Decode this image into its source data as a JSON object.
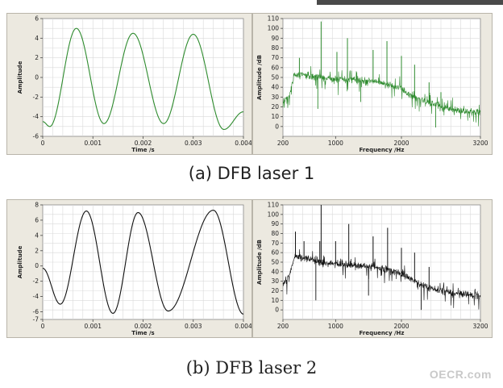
{
  "captions": {
    "a": "(a) DFB laser 1",
    "b": "(b) DFB laser 2"
  },
  "watermark": "OECR.com",
  "colors": {
    "panel_bg": "#ece9e0",
    "plot_bg": "#ffffff",
    "grid": "#d9d9d9",
    "laser1": "#2e8b2e",
    "laser2": "#111111"
  },
  "chart_data": [
    {
      "id": "a_time",
      "type": "line",
      "xlabel": "Time /s",
      "ylabel": "Amplitude",
      "xlim": [
        0,
        0.004
      ],
      "ylim": [
        -6,
        6
      ],
      "xticks": [
        "0",
        "0.001",
        "0.002",
        "0.003",
        "0.004"
      ],
      "yticks": [
        "-6",
        "-4",
        "-2",
        "0",
        "2",
        "4",
        "6"
      ],
      "grid": true,
      "color": "#2e8b2e",
      "series": [
        {
          "x": [
            0,
            0.00014,
            0.00067,
            0.00122,
            0.0018,
            0.00241,
            0.003,
            0.00361,
            0.004
          ],
          "y": [
            -4.5,
            -5.0,
            5.0,
            -4.7,
            4.5,
            -4.7,
            4.4,
            -5.3,
            -3.5
          ]
        }
      ]
    },
    {
      "id": "a_freq",
      "type": "line",
      "xlabel": "Frequency /Hz",
      "ylabel": "Amplitude /dB",
      "xlim": [
        200,
        3200
      ],
      "ylim": [
        -10,
        110
      ],
      "xticks": [
        "200",
        "1000",
        "2000",
        "3200"
      ],
      "yticks": [
        "0",
        "10",
        "20",
        "30",
        "40",
        "50",
        "60",
        "70",
        "80",
        "90",
        "100",
        "110"
      ],
      "grid": true,
      "color": "#2e8b2e",
      "series": [
        {
          "x": [
            200,
            300,
            370,
            500,
            800,
            1000,
            1200,
            1400,
            1600,
            1800,
            2000,
            2200,
            2400,
            2600,
            2800,
            3000,
            3200
          ],
          "y": [
            22,
            32,
            52,
            53,
            50,
            48,
            48,
            47,
            46,
            43,
            38,
            30,
            25,
            20,
            17,
            15,
            14
          ]
        }
      ],
      "peaks": [
        {
          "x": 450,
          "y": 70
        },
        {
          "x": 780,
          "y": 107
        },
        {
          "x": 1020,
          "y": 76
        },
        {
          "x": 1180,
          "y": 90
        },
        {
          "x": 1570,
          "y": 78
        },
        {
          "x": 1780,
          "y": 87
        },
        {
          "x": 2000,
          "y": 72
        },
        {
          "x": 2200,
          "y": 63
        },
        {
          "x": 2420,
          "y": 45
        },
        {
          "x": 2600,
          "y": 35
        }
      ],
      "dips": [
        {
          "x": 730,
          "y": 18
        },
        {
          "x": 1380,
          "y": 25
        },
        {
          "x": 2520,
          "y": -1
        }
      ]
    },
    {
      "id": "b_time",
      "type": "line",
      "xlabel": "Time /s",
      "ylabel": "Amplitude",
      "xlim": [
        0,
        0.004
      ],
      "ylim": [
        -7,
        8
      ],
      "xticks": [
        "0",
        "0.001",
        "0.002",
        "0.003",
        "0.004"
      ],
      "yticks": [
        "-7",
        "-6",
        "-4",
        "-2",
        "0",
        "2",
        "4",
        "6",
        "8"
      ],
      "grid": true,
      "color": "#111111",
      "series": [
        {
          "x": [
            0,
            0.00035,
            0.00087,
            0.0014,
            0.0019,
            0.0025,
            0.0034,
            0.004
          ],
          "y": [
            -0.3,
            -5.0,
            7.2,
            -6.2,
            7.0,
            -5.9,
            7.3,
            -6.3
          ]
        }
      ]
    },
    {
      "id": "b_freq",
      "type": "line",
      "xlabel": "Frequency /Hz",
      "ylabel": "Amplitude /dB",
      "xlim": [
        200,
        3200
      ],
      "ylim": [
        -10,
        110
      ],
      "xticks": [
        "200",
        "1000",
        "2000",
        "3200"
      ],
      "yticks": [
        "0",
        "10",
        "20",
        "30",
        "40",
        "50",
        "60",
        "70",
        "80",
        "90",
        "100",
        "110"
      ],
      "grid": true,
      "color": "#111111",
      "series": [
        {
          "x": [
            200,
            300,
            380,
            500,
            800,
            1000,
            1200,
            1400,
            1600,
            1800,
            2000,
            2200,
            2400,
            2600,
            2800,
            3000,
            3200
          ],
          "y": [
            27,
            36,
            56,
            54,
            50,
            48,
            47,
            46,
            45,
            42,
            38,
            30,
            24,
            20,
            17,
            16,
            15
          ]
        }
      ],
      "peaks": [
        {
          "x": 390,
          "y": 82
        },
        {
          "x": 520,
          "y": 72
        },
        {
          "x": 760,
          "y": 72
        },
        {
          "x": 780,
          "y": 110
        },
        {
          "x": 1000,
          "y": 72
        },
        {
          "x": 1200,
          "y": 90
        },
        {
          "x": 1570,
          "y": 77
        },
        {
          "x": 1790,
          "y": 86
        },
        {
          "x": 2000,
          "y": 65
        },
        {
          "x": 2200,
          "y": 60
        },
        {
          "x": 2420,
          "y": 45
        }
      ],
      "dips": [
        {
          "x": 700,
          "y": 10
        },
        {
          "x": 1500,
          "y": 15
        },
        {
          "x": 2300,
          "y": 0
        }
      ]
    }
  ]
}
